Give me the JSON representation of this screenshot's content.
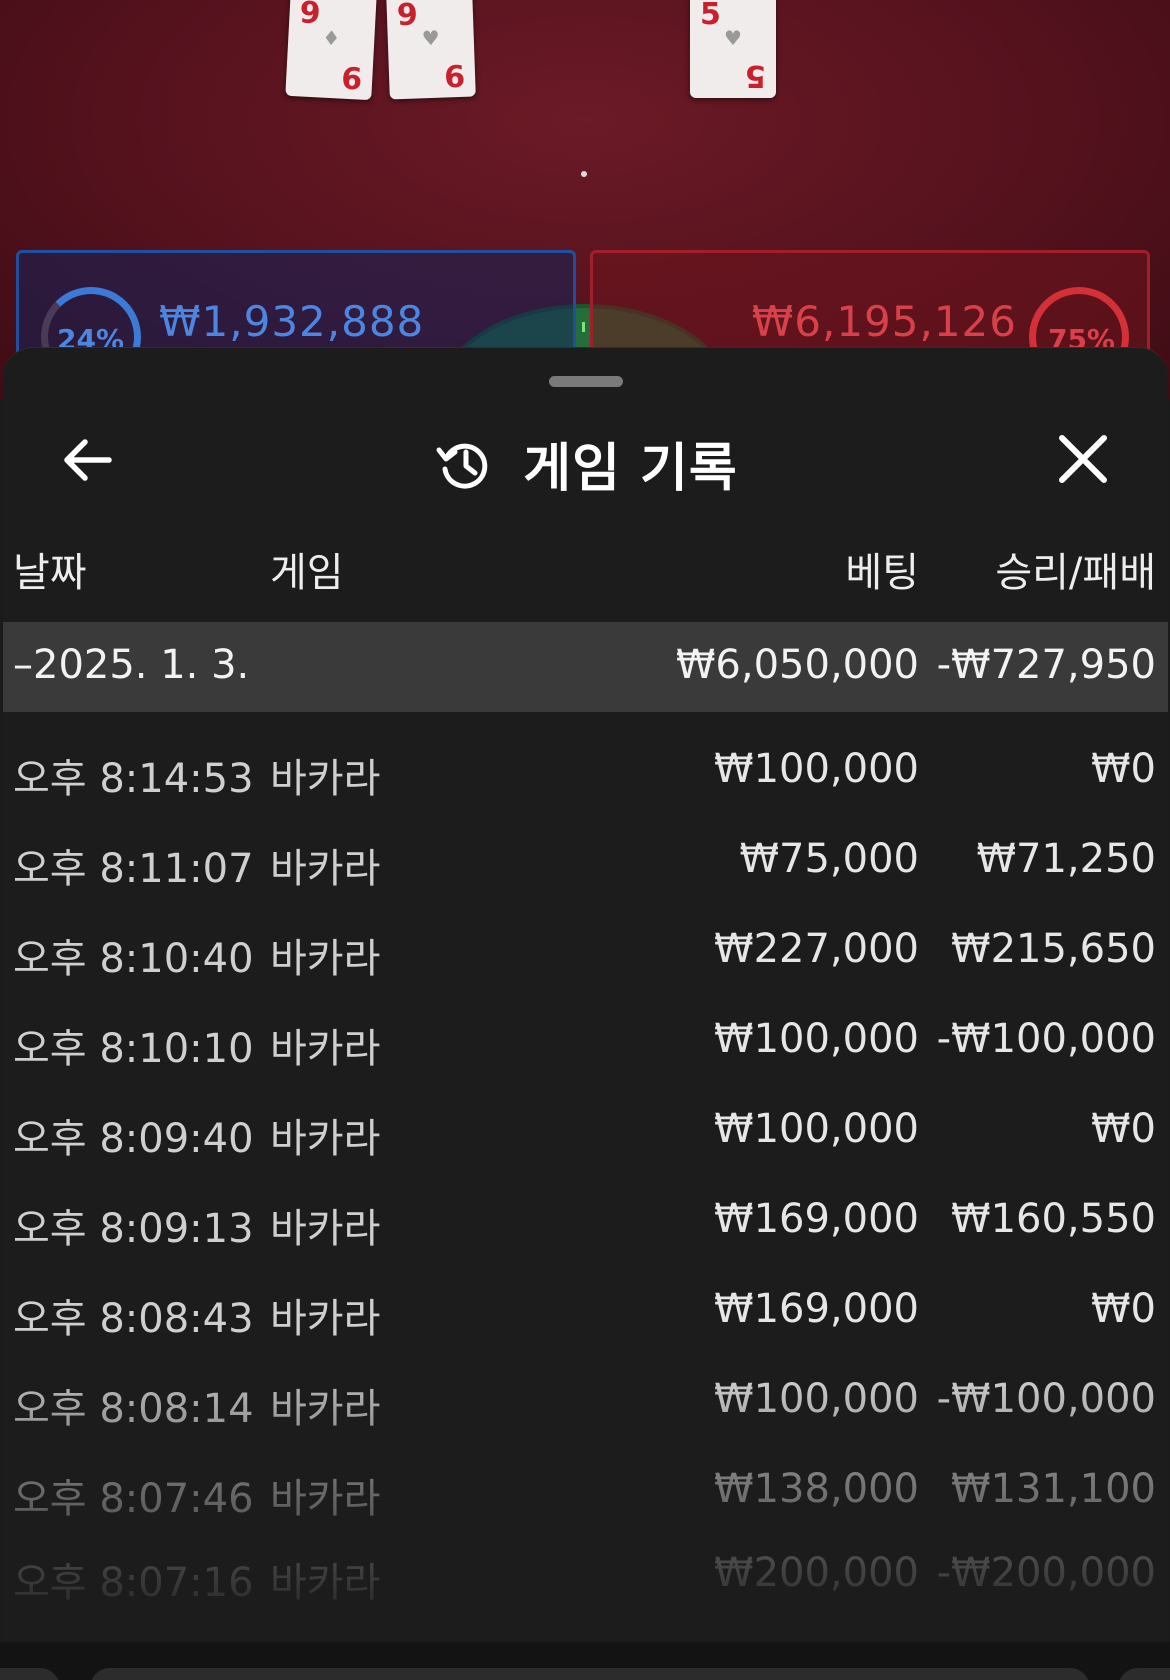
{
  "colors": {
    "table_felt": "#55121d",
    "player_blue": "#4d86e0",
    "banker_red": "#d8414a",
    "sheet_bg": "#1c1c1c",
    "date_row_bg": "#3a3a3a"
  },
  "game_table": {
    "cards": [
      {
        "rank": "9",
        "suit": "♦"
      },
      {
        "rank": "9",
        "suit": "♥"
      },
      {
        "rank": "5",
        "suit": "♥"
      }
    ],
    "player": {
      "percent": "24%",
      "amount": "₩1,932,888"
    },
    "banker": {
      "percent": "75%",
      "amount": "₩6,195,126"
    }
  },
  "sheet": {
    "title": "게임 기록",
    "back_icon": "arrow-left-icon",
    "history_icon": "history-icon",
    "close_icon": "close-icon"
  },
  "table": {
    "headers": {
      "date": "날짜",
      "game": "게임",
      "bet": "베팅",
      "result": "승리/패배"
    },
    "date_group": {
      "date": "–2025. 1. 3.",
      "bet": "₩6,050,000",
      "result": "-₩727,950"
    },
    "rows": [
      {
        "time": "오후 8:14:53",
        "game": "바카라",
        "bet": "₩100,000",
        "result": "₩0"
      },
      {
        "time": "오후 8:11:07",
        "game": "바카라",
        "bet": "₩75,000",
        "result": "₩71,250"
      },
      {
        "time": "오후 8:10:40",
        "game": "바카라",
        "bet": "₩227,000",
        "result": "₩215,650"
      },
      {
        "time": "오후 8:10:10",
        "game": "바카라",
        "bet": "₩100,000",
        "result": "-₩100,000"
      },
      {
        "time": "오후 8:09:40",
        "game": "바카라",
        "bet": "₩100,000",
        "result": "₩0"
      },
      {
        "time": "오후 8:09:13",
        "game": "바카라",
        "bet": "₩169,000",
        "result": "₩160,550"
      },
      {
        "time": "오후 8:08:43",
        "game": "바카라",
        "bet": "₩169,000",
        "result": "₩0"
      },
      {
        "time": "오후 8:08:14",
        "game": "바카라",
        "bet": "₩100,000",
        "result": "-₩100,000"
      },
      {
        "time": "오후 8:07:46",
        "game": "바카라",
        "bet": "₩138,000",
        "result": "₩131,100"
      },
      {
        "time": "오후 8:07:16",
        "game": "바카라",
        "bet": "₩200,000",
        "result": "-₩200,000"
      }
    ]
  }
}
